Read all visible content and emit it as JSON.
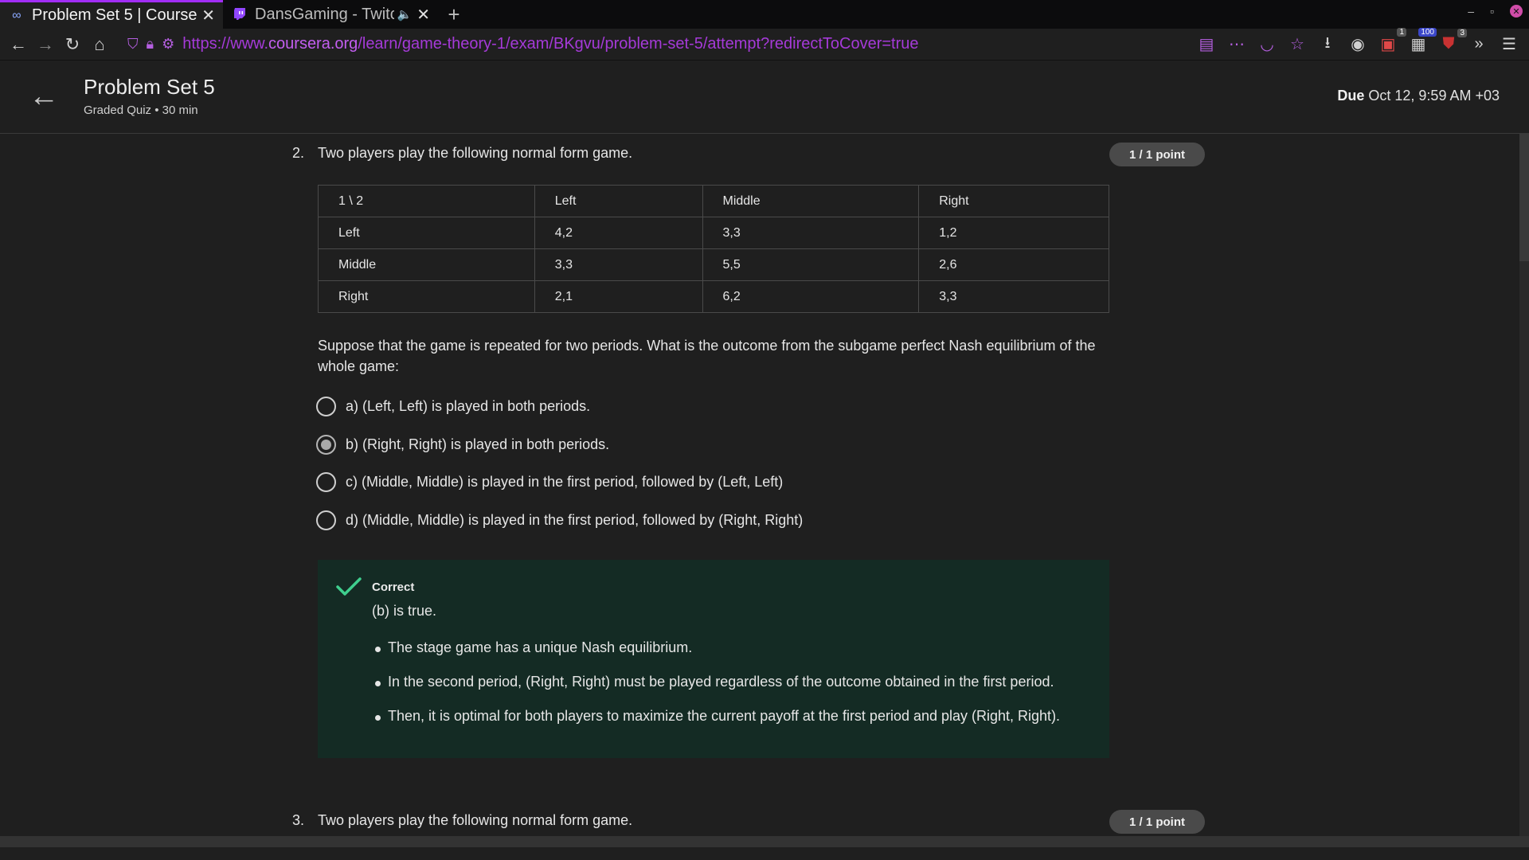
{
  "browser": {
    "tabs": [
      {
        "title": "Problem Set 5 | Course",
        "favicon": "coursera-icon",
        "active": true
      },
      {
        "title": "DansGaming - Twitc",
        "favicon": "twitch-icon",
        "active": false
      }
    ],
    "url_prefix": "https://www.",
    "url_domain": "coursera.org",
    "url_path": "/learn/game-theory-1/exam/BKgvu/problem-set-5/attempt?redirectToCover=true",
    "badges": {
      "ext1": "1",
      "ext2": "100",
      "ext3": "3"
    },
    "accent": "#a12df5"
  },
  "header": {
    "title": "Problem Set 5",
    "subtitle": "Graded Quiz • 30 min",
    "due_label": "Due",
    "due_value": "Oct 12, 9:59 AM +03"
  },
  "question2": {
    "number": "2.",
    "text": "Two players play the following normal form game.",
    "points": "1 / 1 point",
    "table": {
      "header": [
        "1 \\ 2",
        "Left",
        "Middle",
        "Right"
      ],
      "rows": [
        [
          "Left",
          "4,2",
          "3,3",
          "1,2"
        ],
        [
          "Middle",
          "3,3",
          "5,5",
          "2,6"
        ],
        [
          "Right",
          "2,1",
          "6,2",
          "3,3"
        ]
      ]
    },
    "prompt": "Suppose that the game is repeated for two periods. What is the outcome from the subgame perfect Nash equilibrium of the whole game:",
    "options": [
      {
        "label": "a) (Left, Left) is played in both periods.",
        "selected": false
      },
      {
        "label": "b) (Right, Right) is played in both periods.",
        "selected": true
      },
      {
        "label": "c) (Middle, Middle) is played in the first period, followed by (Left, Left)",
        "selected": false
      },
      {
        "label": "d) (Middle, Middle) is played in the first period, followed by (Right, Right)",
        "selected": false
      }
    ],
    "feedback": {
      "status": "Correct",
      "summary": "(b) is true.",
      "points": [
        "The stage game has a unique Nash equilibrium.",
        "In the second period, (Right, Right) must be played regardless of the outcome obtained in the first period.",
        "Then, it is optimal for both players to maximize the current payoff at the first period and play (Right, Right)."
      ],
      "color": "#142b24",
      "check_color": "#3fcf8e"
    }
  },
  "question3": {
    "number": "3.",
    "text": "Two players play the following normal form game.",
    "points": "1 / 1 point"
  }
}
